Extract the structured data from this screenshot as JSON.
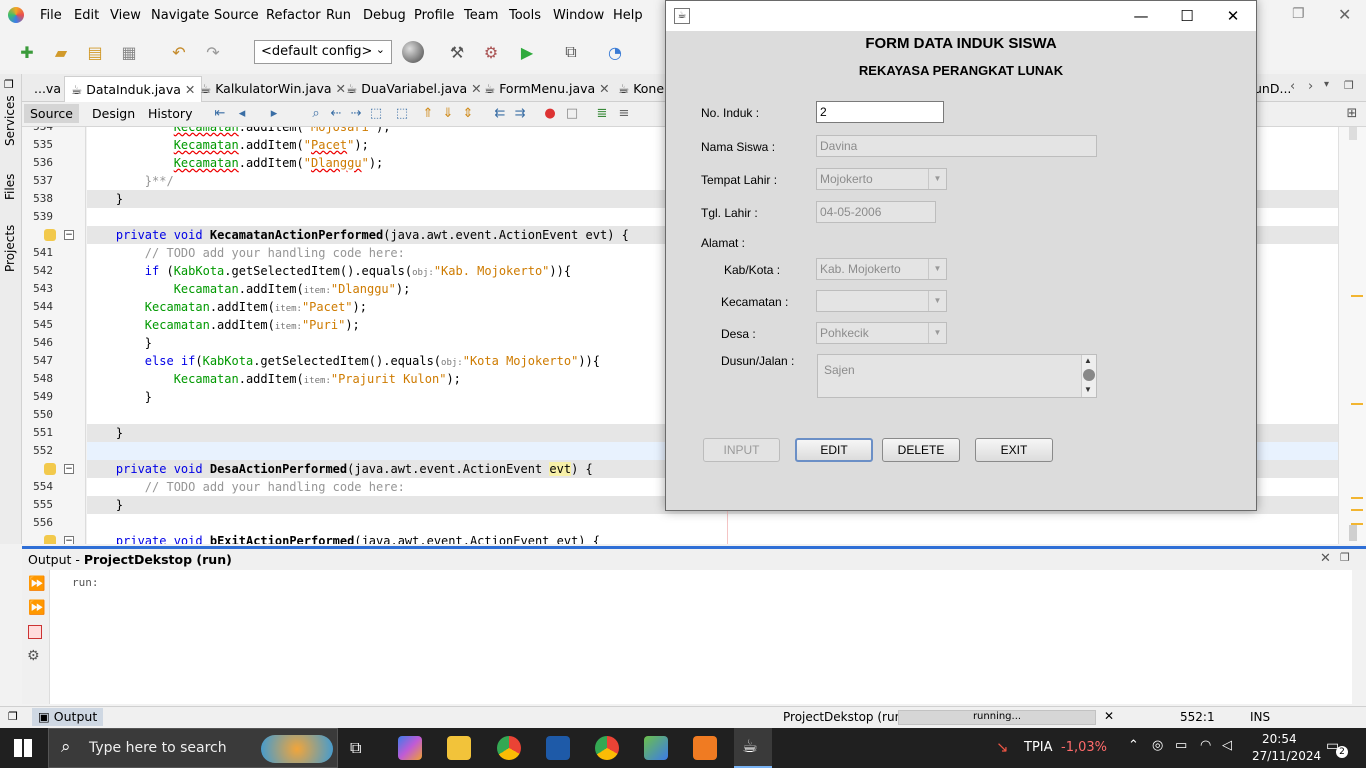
{
  "menu": [
    "File",
    "Edit",
    "View",
    "Navigate",
    "Source",
    "Refactor",
    "Run",
    "Debug",
    "Profile",
    "Team",
    "Tools",
    "Window",
    "Help"
  ],
  "toolbar": {
    "config": "<default config>"
  },
  "tabs": [
    {
      "label": "...va",
      "close": ""
    },
    {
      "label": "DataInduk.java",
      "close": "✕"
    },
    {
      "label": "KalkulatorWin.java",
      "close": "✕"
    },
    {
      "label": "DuaVariabel.java",
      "close": "✕"
    },
    {
      "label": "FormMenu.java",
      "close": "✕"
    },
    {
      "label": "Konel",
      "close": ""
    },
    {
      "label": "unD...",
      "close": ""
    }
  ],
  "sidebar": [
    "Services",
    "Files",
    "Projects"
  ],
  "editor_toolbar": {
    "source": "Source",
    "design": "Design",
    "history": "History"
  },
  "code_lines": [
    {
      "n": "534",
      "html": "            <span class=\"fld err\">Kecamatan</span>.addItem(<span class=\"st\">\"Mojosari\"</span>);",
      "hl": false
    },
    {
      "n": "535",
      "html": "            <span class=\"fld err\">Kecamatan</span>.addItem(<span class=\"st\">\"<span class='err'>Pacet</span>\"</span>);",
      "hl": false
    },
    {
      "n": "536",
      "html": "            <span class=\"fld err\">Kecamatan</span>.addItem(<span class=\"st\">\"<span class='err'>Dlanggu</span>\"</span>);",
      "hl": false
    },
    {
      "n": "537",
      "html": "        <span class=\"cm\">}**/</span>",
      "hl": false
    },
    {
      "n": "538",
      "html": "    }",
      "hl": true
    },
    {
      "n": "539",
      "html": "",
      "hl": false
    },
    {
      "n": "",
      "html": "    <span class=\"kw\">private void</span> <span class=\"mt\">KecamatanActionPerformed</span>(java.awt.event.ActionEvent evt) {",
      "hl": true
    },
    {
      "n": "541",
      "html": "        <span class=\"cm\">// TODO add your handling code here:</span>",
      "hl": false
    },
    {
      "n": "542",
      "html": "        <span class=\"kw\">if</span> (<span class=\"fld\">KabKota</span>.getSelectedItem().equals(<span class=\"hint\">obj:</span><span class=\"st\">\"Kab. Mojokerto\"</span>)){",
      "hl": false
    },
    {
      "n": "543",
      "html": "            <span class=\"fld\">Kecamatan</span>.addItem(<span class=\"hint\">item:</span><span class=\"st\">\"Dlanggu\"</span>);",
      "hl": false
    },
    {
      "n": "544",
      "html": "        <span class=\"fld\">Kecamatan</span>.addItem(<span class=\"hint\">item:</span><span class=\"st\">\"Pacet\"</span>);",
      "hl": false
    },
    {
      "n": "545",
      "html": "        <span class=\"fld\">Kecamatan</span>.addItem(<span class=\"hint\">item:</span><span class=\"st\">\"Puri\"</span>);",
      "hl": false
    },
    {
      "n": "546",
      "html": "        }",
      "hl": false
    },
    {
      "n": "547",
      "html": "        <span class=\"kw\">else if</span>(<span class=\"fld\">KabKota</span>.getSelectedItem().equals(<span class=\"hint\">obj:</span><span class=\"st\">\"Kota Mojokerto\"</span>)){",
      "hl": false
    },
    {
      "n": "548",
      "html": "            <span class=\"fld\">Kecamatan</span>.addItem(<span class=\"hint\">item:</span><span class=\"st\">\"Prajurit Kulon\"</span>);",
      "hl": false
    },
    {
      "n": "549",
      "html": "        }",
      "hl": false
    },
    {
      "n": "550",
      "html": "",
      "hl": false
    },
    {
      "n": "551",
      "html": "    }",
      "hl": true
    },
    {
      "n": "552",
      "html": "",
      "hl": false,
      "cur": true
    },
    {
      "n": "",
      "html": "    <span class=\"kw\">private void</span> <span class=\"mt\">DesaActionPerformed</span>(java.awt.event.ActionEvent <span style='background:#f7f0a8'>evt</span>) {",
      "hl": true
    },
    {
      "n": "554",
      "html": "        <span class=\"cm\">// TODO add your handling code here:</span>",
      "hl": false
    },
    {
      "n": "555",
      "html": "    }",
      "hl": true
    },
    {
      "n": "556",
      "html": "",
      "hl": false
    },
    {
      "n": "",
      "html": "    <span class=\"kw\">private void</span> <span class=\"mt\">bExitActionPerformed</span>(java.awt.event.ActionEvent evt) {",
      "hl": false
    }
  ],
  "output": {
    "title_prefix": "Output - ",
    "title_bold": "ProjectDekstop (run)",
    "text": "run:"
  },
  "status": {
    "output_tab": "Output",
    "project": "ProjectDekstop (run)",
    "progress": "running...",
    "position": "552:1",
    "mode": "INS"
  },
  "taskbar": {
    "search_placeholder": "Type here to search",
    "stock": "TPIA",
    "stock_change": "-1,03%",
    "time": "20:54",
    "date": "27/11/2024",
    "notif": "2"
  },
  "dialog": {
    "title1": "FORM DATA INDUK SISWA",
    "title2": "REKAYASA PERANGKAT LUNAK",
    "labels": {
      "no_induk": "No. Induk :",
      "nama": "Nama Siswa :",
      "tempat": "Tempat Lahir :",
      "tgl": "Tgl. Lahir :",
      "alamat": "Alamat :",
      "kabkota": "Kab/Kota :",
      "kecamatan": "Kecamatan :",
      "desa": "Desa :",
      "dusun": "Dusun/Jalan :"
    },
    "values": {
      "no_induk": "2",
      "nama": "Davina",
      "tempat": "Mojokerto",
      "tgl": "04-05-2006",
      "kabkota": "Kab. Mojokerto",
      "kecamatan": "",
      "desa": "Pohkecik",
      "dusun": "Sajen"
    },
    "buttons": {
      "input": "INPUT",
      "edit": "EDIT",
      "delete": "DELETE",
      "exit": "EXIT"
    }
  }
}
